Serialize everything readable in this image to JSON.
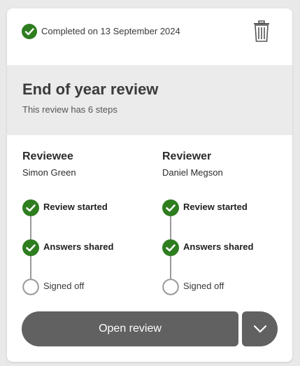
{
  "status": {
    "completed_text": "Completed on 13 September 2024",
    "icon": "check-circle-icon",
    "color": "#2e7d1f"
  },
  "actions": {
    "delete_icon": "trash-icon"
  },
  "review": {
    "title": "End of year review",
    "subtitle": "This review has 6 steps"
  },
  "reviewee": {
    "heading": "Reviewee",
    "name": "Simon Green",
    "steps": [
      {
        "label": "Review started",
        "done": true
      },
      {
        "label": "Answers shared",
        "done": true
      },
      {
        "label": "Signed off",
        "done": false
      }
    ]
  },
  "reviewer": {
    "heading": "Reviewer",
    "name": "Daniel Megson",
    "steps": [
      {
        "label": "Review started",
        "done": true
      },
      {
        "label": "Answers shared",
        "done": true
      },
      {
        "label": "Signed off",
        "done": false
      }
    ]
  },
  "footer": {
    "open_label": "Open review",
    "more_icon": "chevron-down-icon",
    "button_color": "#616161"
  }
}
